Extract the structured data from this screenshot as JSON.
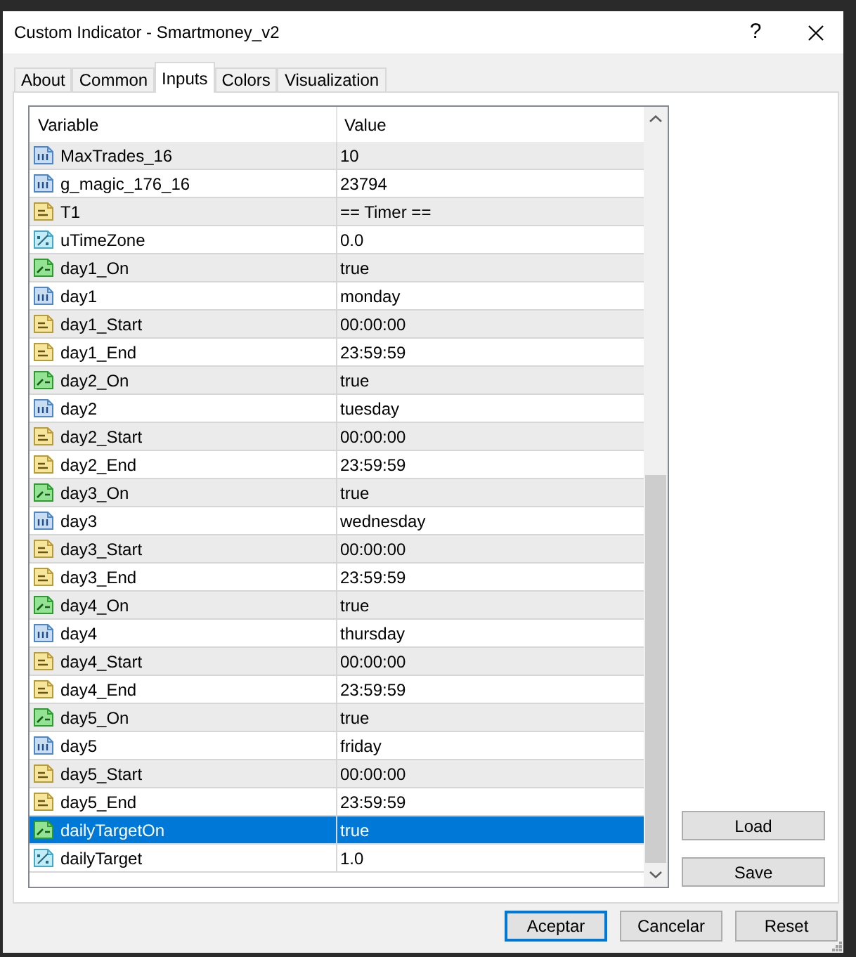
{
  "window": {
    "title": "Custom Indicator - Smartmoney_v2",
    "help": "?"
  },
  "tabs": [
    {
      "label": "About",
      "selected": false
    },
    {
      "label": "Common",
      "selected": false
    },
    {
      "label": "Inputs",
      "selected": true
    },
    {
      "label": "Colors",
      "selected": false
    },
    {
      "label": "Visualization",
      "selected": false
    }
  ],
  "inputs_table": {
    "columns": [
      "Variable",
      "Value"
    ],
    "rows": [
      {
        "kind": "int",
        "variable": "MaxTrades_16",
        "value": "10",
        "selected": false
      },
      {
        "kind": "int",
        "variable": "g_magic_176_16",
        "value": "23794",
        "selected": false
      },
      {
        "kind": "string",
        "variable": "T1",
        "value": "== Timer ==",
        "selected": false
      },
      {
        "kind": "double",
        "variable": "uTimeZone",
        "value": "0.0",
        "selected": false
      },
      {
        "kind": "bool",
        "variable": "day1_On",
        "value": "true",
        "selected": false
      },
      {
        "kind": "int",
        "variable": "day1",
        "value": "monday",
        "selected": false
      },
      {
        "kind": "string",
        "variable": "day1_Start",
        "value": "00:00:00",
        "selected": false
      },
      {
        "kind": "string",
        "variable": "day1_End",
        "value": "23:59:59",
        "selected": false
      },
      {
        "kind": "bool",
        "variable": "day2_On",
        "value": "true",
        "selected": false
      },
      {
        "kind": "int",
        "variable": "day2",
        "value": "tuesday",
        "selected": false
      },
      {
        "kind": "string",
        "variable": "day2_Start",
        "value": "00:00:00",
        "selected": false
      },
      {
        "kind": "string",
        "variable": "day2_End",
        "value": "23:59:59",
        "selected": false
      },
      {
        "kind": "bool",
        "variable": "day3_On",
        "value": "true",
        "selected": false
      },
      {
        "kind": "int",
        "variable": "day3",
        "value": "wednesday",
        "selected": false
      },
      {
        "kind": "string",
        "variable": "day3_Start",
        "value": "00:00:00",
        "selected": false
      },
      {
        "kind": "string",
        "variable": "day3_End",
        "value": "23:59:59",
        "selected": false
      },
      {
        "kind": "bool",
        "variable": "day4_On",
        "value": "true",
        "selected": false
      },
      {
        "kind": "int",
        "variable": "day4",
        "value": "thursday",
        "selected": false
      },
      {
        "kind": "string",
        "variable": "day4_Start",
        "value": "00:00:00",
        "selected": false
      },
      {
        "kind": "string",
        "variable": "day4_End",
        "value": "23:59:59",
        "selected": false
      },
      {
        "kind": "bool",
        "variable": "day5_On",
        "value": "true",
        "selected": false
      },
      {
        "kind": "int",
        "variable": "day5",
        "value": "friday",
        "selected": false
      },
      {
        "kind": "string",
        "variable": "day5_Start",
        "value": "00:00:00",
        "selected": false
      },
      {
        "kind": "string",
        "variable": "day5_End",
        "value": "23:59:59",
        "selected": false
      },
      {
        "kind": "bool",
        "variable": "dailyTargetOn",
        "value": "true",
        "selected": true
      },
      {
        "kind": "double",
        "variable": "dailyTarget",
        "value": "1.0",
        "selected": false
      }
    ]
  },
  "side_buttons": [
    "Load",
    "Save"
  ],
  "dialog_buttons": [
    {
      "label": "Aceptar",
      "default": true
    },
    {
      "label": "Cancelar",
      "default": false
    },
    {
      "label": "Reset",
      "default": false
    }
  ]
}
